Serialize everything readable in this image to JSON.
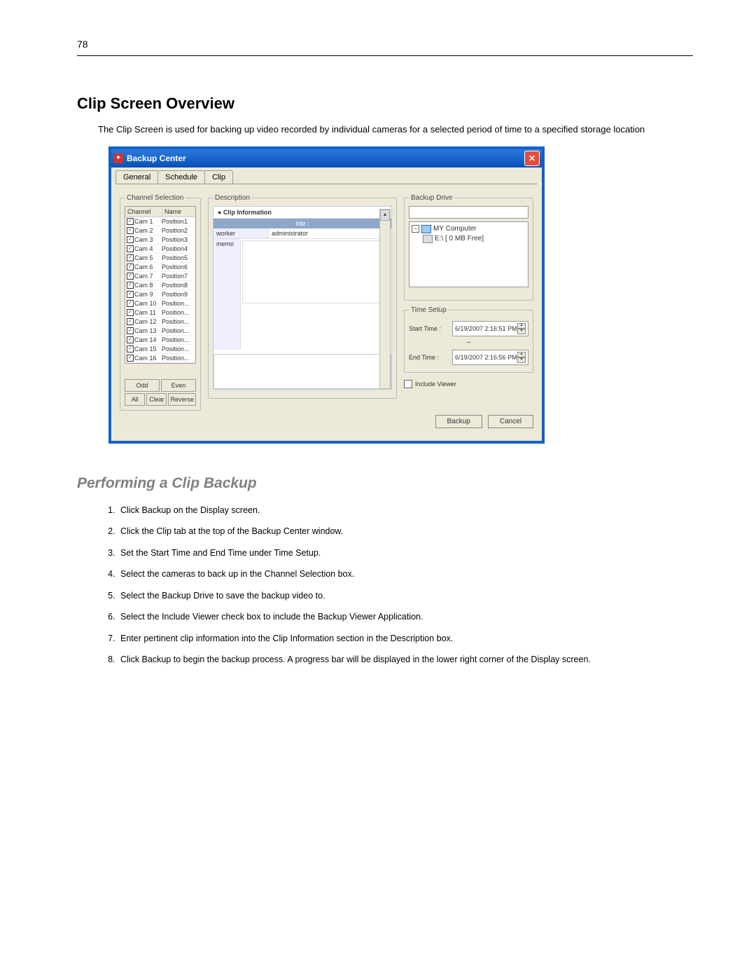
{
  "page_number": "78",
  "heading1": "Clip Screen Overview",
  "intro": "The Clip Screen is used for backing up video recorded by individual cameras for a selected period of time to a specified storage location",
  "window": {
    "title": "Backup Center",
    "tabs": {
      "general": "General",
      "schedule": "Schedule",
      "clip": "Clip"
    },
    "channel_selection": {
      "legend": "Channel Selection",
      "col1": "Channel",
      "col2": "Name",
      "rows": [
        {
          "ch": "Cam 1",
          "name": "Position1"
        },
        {
          "ch": "Cam 2",
          "name": "Position2"
        },
        {
          "ch": "Cam 3",
          "name": "Position3"
        },
        {
          "ch": "Cam 4",
          "name": "Position4"
        },
        {
          "ch": "Cam 5",
          "name": "Position5"
        },
        {
          "ch": "Cam 6",
          "name": "Position6"
        },
        {
          "ch": "Cam 7",
          "name": "Position7"
        },
        {
          "ch": "Cam 8",
          "name": "Position8"
        },
        {
          "ch": "Cam 9",
          "name": "Position9"
        },
        {
          "ch": "Cam 10",
          "name": "Position..."
        },
        {
          "ch": "Cam 11",
          "name": "Position..."
        },
        {
          "ch": "Cam 12",
          "name": "Position..."
        },
        {
          "ch": "Cam 13",
          "name": "Position..."
        },
        {
          "ch": "Cam 14",
          "name": "Position..."
        },
        {
          "ch": "Cam 15",
          "name": "Position..."
        },
        {
          "ch": "Cam 16",
          "name": "Position..."
        }
      ],
      "btn_odd": "Odd",
      "btn_even": "Even",
      "btn_all": "All",
      "btn_clear": "Clear",
      "btn_reverse": "Reverse"
    },
    "description": {
      "legend": "Description",
      "clip_info": "Clip Information",
      "title_row": "title :",
      "worker": "worker",
      "admin": "administrator",
      "memo": "memo"
    },
    "backup_drive": {
      "legend": "Backup Drive",
      "my_computer": "MY Computer",
      "drive": "E:\\ [ 0 MB Free]"
    },
    "time_setup": {
      "legend": "Time Setup",
      "start_label": "Start Time :",
      "start_value": "6/19/2007   2:16:51 PM",
      "tilde": "~",
      "end_label": "End Time :",
      "end_value": "6/19/2007   2:16:56 PM"
    },
    "include_viewer": "Include Viewer",
    "btn_backup": "Backup",
    "btn_cancel": "Cancel"
  },
  "heading2": "Performing a Clip Backup",
  "steps": [
    "Click Backup on the Display screen.",
    "Click the Clip tab at the top of the Backup Center window.",
    "Set the Start Time and End Time under Time Setup.",
    "Select the cameras to back up in the Channel Selection box.",
    "Select the Backup Drive to save the backup video to.",
    "Select the Include Viewer check box to include the Backup Viewer Application.",
    "Enter pertinent clip information into the Clip Information section in the Description box.",
    "Click Backup to begin the backup process. A progress bar will be displayed in the lower right corner of the Display screen."
  ]
}
